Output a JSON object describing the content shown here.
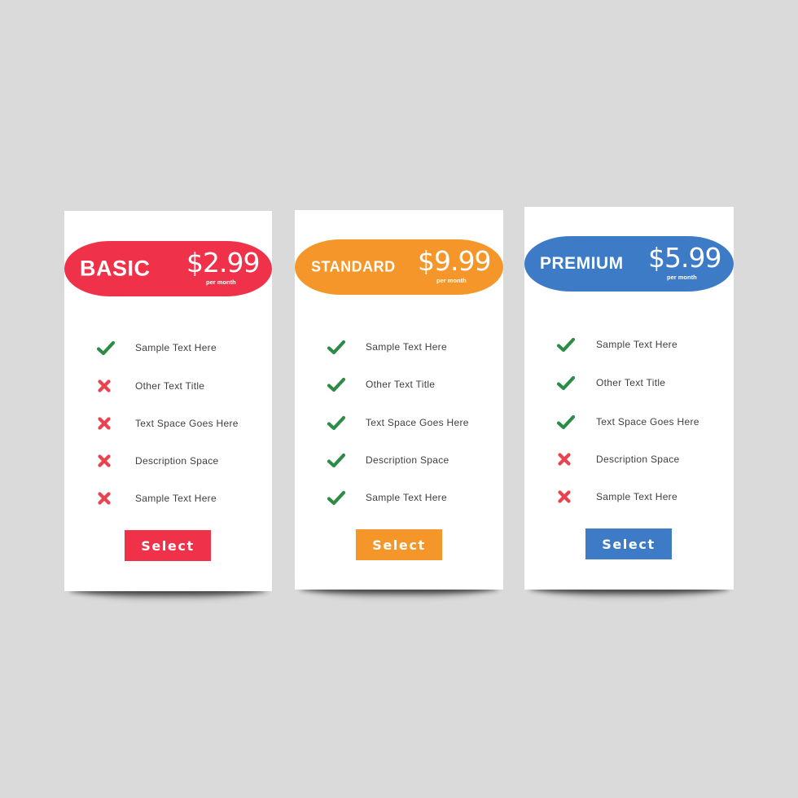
{
  "plans": [
    {
      "name": "BASIC",
      "price": "$2.99",
      "period": "per month",
      "color": "#ef3249",
      "features": [
        {
          "label": "Sample Text Here",
          "included": true
        },
        {
          "label": "Other Text Title",
          "included": false
        },
        {
          "label": "Text Space Goes Here",
          "included": false
        },
        {
          "label": "Description Space",
          "included": false
        },
        {
          "label": "Sample Text Here",
          "included": false
        }
      ],
      "button_label": "Select"
    },
    {
      "name": "STANDARD",
      "price": "$9.99",
      "period": "per month",
      "color": "#f5962a",
      "features": [
        {
          "label": "Sample Text Here",
          "included": true
        },
        {
          "label": "Other Text Title",
          "included": true
        },
        {
          "label": "Text Space Goes Here",
          "included": true
        },
        {
          "label": "Description Space",
          "included": true
        },
        {
          "label": "Sample Text Here",
          "included": true
        }
      ],
      "button_label": "Select"
    },
    {
      "name": "PREMIUM",
      "price": "$5.99",
      "period": "per month",
      "color": "#3e7bc6",
      "features": [
        {
          "label": "Sample Text Here",
          "included": true
        },
        {
          "label": "Other Text Title",
          "included": true
        },
        {
          "label": "Text Space Goes Here",
          "included": true
        },
        {
          "label": "Description Space",
          "included": false
        },
        {
          "label": "Sample Text Here",
          "included": false
        }
      ],
      "button_label": "Select"
    }
  ],
  "icons": {
    "included": "check-icon",
    "excluded": "cross-icon",
    "check_color": "#2e8b47",
    "cross_color": "#e8434f"
  }
}
